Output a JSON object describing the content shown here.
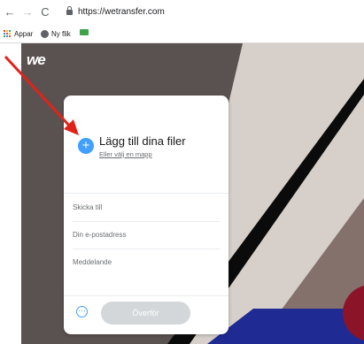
{
  "browser": {
    "url": "https://wetransfer.com",
    "bookmarks": [
      {
        "label": "Appar",
        "icon": "apps-grid-icon"
      },
      {
        "label": "Ny flik",
        "icon": "globe-icon"
      },
      {
        "label": "",
        "icon": "folder-icon"
      }
    ]
  },
  "page": {
    "logo": "we",
    "upload": {
      "title": "Lägg till dina filer",
      "subtitle": "Eller välj en mapp"
    },
    "fields": {
      "to_placeholder": "Skicka till",
      "email_placeholder": "Din e-postadress",
      "message_placeholder": "Meddelande"
    },
    "transfer_label": "Överför"
  },
  "colors": {
    "accent": "#409fff",
    "annotation_arrow": "#e0231a",
    "button_disabled": "#d4d7d9",
    "background_art": "#5a5250"
  }
}
